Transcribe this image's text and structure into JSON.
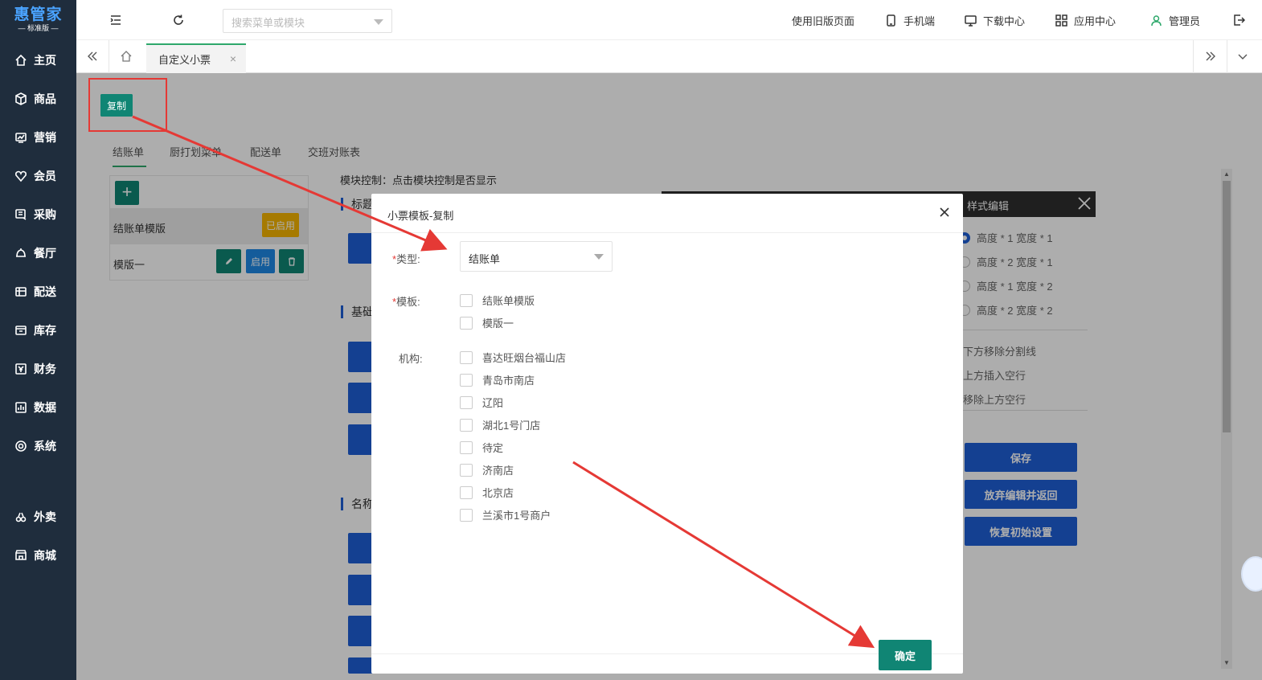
{
  "app": {
    "brand": "惠管家",
    "edition": "— 标准版 —"
  },
  "sidebar": {
    "items": [
      {
        "label": "主页",
        "icon": "home-icon"
      },
      {
        "label": "商品",
        "icon": "cube-icon"
      },
      {
        "label": "营销",
        "icon": "chart-icon"
      },
      {
        "label": "会员",
        "icon": "heart-icon"
      },
      {
        "label": "采购",
        "icon": "cart-icon"
      },
      {
        "label": "餐厅",
        "icon": "bell-icon"
      },
      {
        "label": "配送",
        "icon": "truck-icon"
      },
      {
        "label": "库存",
        "icon": "warehouse-icon"
      },
      {
        "label": "财务",
        "icon": "yen-icon"
      },
      {
        "label": "数据",
        "icon": "bar-chart-icon"
      },
      {
        "label": "系统",
        "icon": "settings-icon"
      },
      {
        "label": "外卖",
        "icon": "link-icon"
      },
      {
        "label": "商城",
        "icon": "store-icon"
      }
    ]
  },
  "header": {
    "search_placeholder": "搜索菜单或模块",
    "links": {
      "old_version": "使用旧版页面",
      "mobile": "手机端",
      "download": "下载中心",
      "apps": "应用中心",
      "user": "管理员"
    }
  },
  "tabs": {
    "active": "自定义小票",
    "close": "×"
  },
  "page": {
    "copy_button": "复制",
    "content_tabs": [
      "结账单",
      "厨打划菜单",
      "配送单",
      "交班对账表"
    ],
    "templates": {
      "add": "+",
      "row1_label": "结账单模版",
      "row1_badge": "已启用",
      "row2_label": "模版一",
      "row2_enable": "启用"
    },
    "module_control": "模块控制：点击模块控制是否显示",
    "sections": {
      "title": "标题",
      "basic": "基础",
      "name": "名称"
    }
  },
  "style_panel": {
    "title": "样式编辑",
    "options": [
      "高度 * 1 宽度 * 1",
      "高度 * 2 宽度 * 1",
      "高度 * 1 宽度 * 2",
      "高度 * 2 宽度 * 2"
    ],
    "actions": [
      "下方移除分割线",
      "上方插入空行",
      "移除上方空行"
    ],
    "buttons": {
      "save": "保存",
      "discard": "放弃编辑并返回",
      "reset": "恢复初始设置"
    }
  },
  "dialog": {
    "title": "小票模板-复制",
    "close": "×",
    "type_label": "类型:",
    "type_value": "结账单",
    "template_label": "模板:",
    "templates": [
      "结账单模版",
      "模版一"
    ],
    "org_label": "机构:",
    "orgs": [
      "喜达旺烟台福山店",
      "青岛市南店",
      "辽阳",
      "湖北1号门店",
      "待定",
      "济南店",
      "北京店",
      "兰溪市1号商户"
    ],
    "confirm": "确定"
  },
  "colors": {
    "primary_green": "#108574",
    "primary_blue": "#1e5fd6",
    "warning": "#f5b400",
    "annotation_red": "#e53935",
    "sidebar_bg": "#1f2d3d"
  }
}
